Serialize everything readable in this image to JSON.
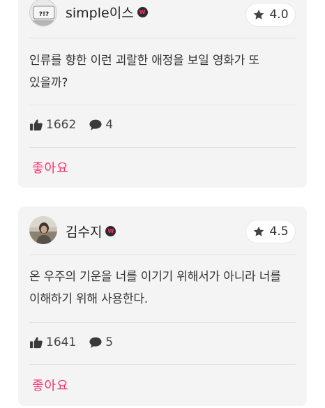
{
  "reviews": [
    {
      "username": "simple이스",
      "rating": "4.0",
      "text": "인류를 향한 이런 괴랄한 애정을 보일 영화가 또 있을까?",
      "likes": "1662",
      "comments": "4",
      "like_label": "좋아요"
    },
    {
      "username": "김수지",
      "rating": "4.5",
      "text": "온 우주의 기운을 너를 이기기 위해서가 아니라 너를 이해하기 위해 사용한다.",
      "likes": "1641",
      "comments": "5",
      "like_label": "좋아요"
    }
  ],
  "icons": {
    "rating": "star-icon",
    "likes": "thumbs-up-icon",
    "comments": "speech-bubble-icon",
    "badge": "verified-badge-icon"
  },
  "colors": {
    "accent": "#ff2f6e",
    "card_bg": "#f4f4f4",
    "badge_bg": "#2b2b2b"
  }
}
